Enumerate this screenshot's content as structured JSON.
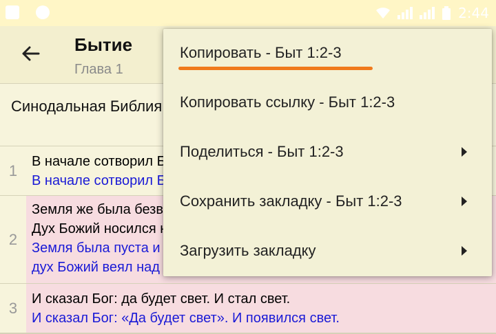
{
  "status_bar": {
    "time": "2:44"
  },
  "app_bar": {
    "title": "Бытие",
    "subtitle": "Глава 1"
  },
  "content": {
    "translation_name": "Синодальная Библия",
    "verses": [
      {
        "number": "1",
        "lines": [
          {
            "text": "В начале сотворил Бог небо и землю.",
            "style": "ref"
          },
          {
            "text": "В начале сотворил Бог небо и землю.",
            "style": "alt"
          }
        ]
      },
      {
        "number": "2",
        "lines": [
          {
            "text": "Земля же была безвидна и пуста, и тьма над бездною, и",
            "style": "ref"
          },
          {
            "text": "Дух Божий носился над водою.",
            "style": "ref"
          },
          {
            "text": "Земля была пуста и безвидна, тьма была над бездной, и",
            "style": "alt"
          },
          {
            "text": "дух Божий веял над водами.",
            "style": "alt"
          }
        ]
      },
      {
        "number": "3",
        "lines": [
          {
            "text": "И сказал Бог: да будет свет. И стал свет.",
            "style": "ref"
          },
          {
            "text": "И сказал Бог: «Да будет свет». И появился свет.",
            "style": "alt"
          }
        ]
      }
    ]
  },
  "menu": {
    "items": [
      {
        "label": "Копировать - Быт 1:2-3",
        "submenu": false,
        "highlighted": true
      },
      {
        "label": "Копировать ссылку - Быт 1:2-3",
        "submenu": false
      },
      {
        "label": "Поделиться - Быт 1:2-3",
        "submenu": true
      },
      {
        "label": "Сохранить закладку - Быт 1:2-3",
        "submenu": true
      },
      {
        "label": "Загрузить закладку",
        "submenu": true
      }
    ],
    "highlight_color": "#f07a1c"
  }
}
